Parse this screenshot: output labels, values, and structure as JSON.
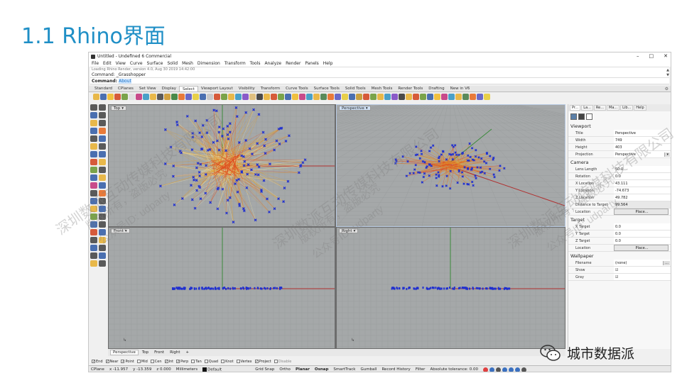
{
  "slide": {
    "title": "1.1 Rhino界面"
  },
  "window": {
    "title": "Untitled - Undefined 6 Commercial",
    "controls": [
      "–",
      "□",
      "✕"
    ]
  },
  "menu": [
    "File",
    "Edit",
    "View",
    "Curve",
    "Surface",
    "Solid",
    "Mesh",
    "Dimension",
    "Transform",
    "Tools",
    "Analyze",
    "Render",
    "Panels",
    "Help"
  ],
  "command": {
    "history": "Loading Rhino Render, version 4.0, Aug 30 2019 14:42:00",
    "line1": "Command: _Grasshopper",
    "prompt": "Command:",
    "current": "About"
  },
  "tabs": [
    "Standard",
    "CPlanes",
    "Set View",
    "Display",
    "Select",
    "Viewport Layout",
    "Visibility",
    "Transform",
    "Curve Tools",
    "Surface Tools",
    "Solid Tools",
    "Mesh Tools",
    "Render Tools",
    "Drafting",
    "New in V6"
  ],
  "active_tab": "Select",
  "toolbar_colors": [
    "#e8b84a",
    "#4a6fb0",
    "#f0c040",
    "#d65a3a",
    "#7aa34a",
    "#e0e0e0",
    "#c84a8a",
    "#4aa0c8",
    "#e8b84a",
    "#5a5a5a",
    "#d0a040",
    "#4a8a4a",
    "#e87a3a",
    "#6a6ac8",
    "#e8d04a",
    "#4a6fb0",
    "#c8c8c8",
    "#d65a3a",
    "#7aa34a",
    "#e8b84a",
    "#4aa0c8",
    "#8a5ac8",
    "#e0c080",
    "#4a4a4a",
    "#e8b84a",
    "#d65a3a",
    "#7aa34a",
    "#4a6fb0",
    "#f0c040",
    "#c84a8a",
    "#4aa0c8",
    "#e8b84a",
    "#5a8a5a",
    "#e87a3a",
    "#6a6ac8",
    "#e8d04a",
    "#4a6fb0",
    "#c8a040",
    "#d65a3a",
    "#7aa34a",
    "#e8b84a",
    "#4aa0c8",
    "#8a5ac8",
    "#4a4a4a",
    "#e8b84a",
    "#d65a3a",
    "#7aa34a",
    "#4a6fb0",
    "#f0c040",
    "#c84a8a",
    "#4aa0c8",
    "#e8b84a",
    "#5a8a5a",
    "#e87a3a",
    "#6a6ac8",
    "#e8d04a"
  ],
  "left_toolbar_colors": [
    "#5a5a5a",
    "#5a5a5a",
    "#4a6fb0",
    "#5a5a5a",
    "#e8b84a",
    "#5a5a5a",
    "#4a6fb0",
    "#e87a3a",
    "#5a5a5a",
    "#4a6fb0",
    "#e8b84a",
    "#5a5a5a",
    "#4a6fb0",
    "#4a6fb0",
    "#d65a3a",
    "#e8b84a",
    "#7aa34a",
    "#5a5a5a",
    "#4a6fb0",
    "#e8b84a",
    "#c84a8a",
    "#4a6fb0",
    "#5a5a5a",
    "#e87a3a",
    "#4a6fb0",
    "#5a5a5a",
    "#e8b84a",
    "#4a6fb0",
    "#7aa34a",
    "#5a5a5a",
    "#4a6fb0",
    "#5a5a5a",
    "#d65a3a",
    "#4a6fb0",
    "#5a5a5a",
    "#e8b84a",
    "#4a6fb0",
    "#5a5a5a",
    "#5a5a5a",
    "#4a6fb0",
    "#e8b84a",
    "#5a5a5a"
  ],
  "viewports": {
    "top": "Top",
    "perspective": "Perspective",
    "front": "Front",
    "right": "Right"
  },
  "viewport_tabs": [
    "Perspective",
    "Top",
    "Front",
    "Right"
  ],
  "viewport_tab_add": "+",
  "osnaps": [
    {
      "label": "End",
      "checked": true
    },
    {
      "label": "Near",
      "checked": true
    },
    {
      "label": "Point",
      "checked": true
    },
    {
      "label": "Mid",
      "checked": false
    },
    {
      "label": "Cen",
      "checked": false
    },
    {
      "label": "Int",
      "checked": true
    },
    {
      "label": "Perp",
      "checked": true
    },
    {
      "label": "Tan",
      "checked": false
    },
    {
      "label": "Quad",
      "checked": false
    },
    {
      "label": "Knot",
      "checked": false
    },
    {
      "label": "Vertex",
      "checked": false
    },
    {
      "label": "Project",
      "checked": true
    },
    {
      "label": "Disable",
      "checked": false
    }
  ],
  "status": {
    "cplane": "CPlane",
    "x": "x -11.957",
    "y": "y -13.359",
    "z": "z 0.000",
    "units": "Millimeters",
    "layer": "Default",
    "grid_snap": "Grid Snap",
    "ortho": "Ortho",
    "planar": "Planar",
    "osnap": "Osnap",
    "smarttrack": "SmartTrack",
    "gumball": "Gumball",
    "record_history": "Record History",
    "filter": "Filter",
    "tolerance": "Absolute tolerance: 0.00"
  },
  "props": {
    "tabs": [
      "Pr...",
      "La...",
      "Re...",
      "Ma...",
      "Lib...",
      "Help"
    ],
    "viewport_header": "Viewport",
    "viewport": [
      {
        "k": "Title",
        "v": "Perspective"
      },
      {
        "k": "Width",
        "v": "749"
      },
      {
        "k": "Height",
        "v": "403"
      },
      {
        "k": "Projection",
        "v": "Perspective"
      }
    ],
    "camera_header": "Camera",
    "camera": [
      {
        "k": "Lens Length",
        "v": "50.0"
      },
      {
        "k": "Rotation",
        "v": "0.0"
      },
      {
        "k": "X Location",
        "v": "43.111"
      },
      {
        "k": "Y Location",
        "v": "-74.673"
      },
      {
        "k": "Z Location",
        "v": "49.782"
      },
      {
        "k": "Distance to Target",
        "v": "99.564"
      },
      {
        "k": "Location",
        "v": "Place..."
      }
    ],
    "target_header": "Target",
    "target": [
      {
        "k": "X Target",
        "v": "0.0"
      },
      {
        "k": "Y Target",
        "v": "0.0"
      },
      {
        "k": "Z Target",
        "v": "0.0"
      },
      {
        "k": "Location",
        "v": "Place..."
      }
    ],
    "wallpaper_header": "Wallpaper",
    "wallpaper": [
      {
        "k": "Filename",
        "v": "(none)"
      },
      {
        "k": "Show",
        "v": "☑"
      },
      {
        "k": "Gray",
        "v": "☑"
      }
    ]
  },
  "watermark": {
    "line1": "深圳数派互动传媒科技有限公司",
    "line2": "版权所有，盗版必究",
    "line3": "公众号ID: udparty"
  },
  "brand": {
    "text": "城市数据派"
  },
  "colors": {
    "title": "#1f8fc6",
    "viewport_bg": "#a5a8a9",
    "grid": "#9a9d9e",
    "axis_x": "#b03030",
    "axis_y": "#3a8a3a",
    "points": "#1f2fd0",
    "lines_warm": "#e0a030",
    "lines_hot": "#e05020"
  }
}
